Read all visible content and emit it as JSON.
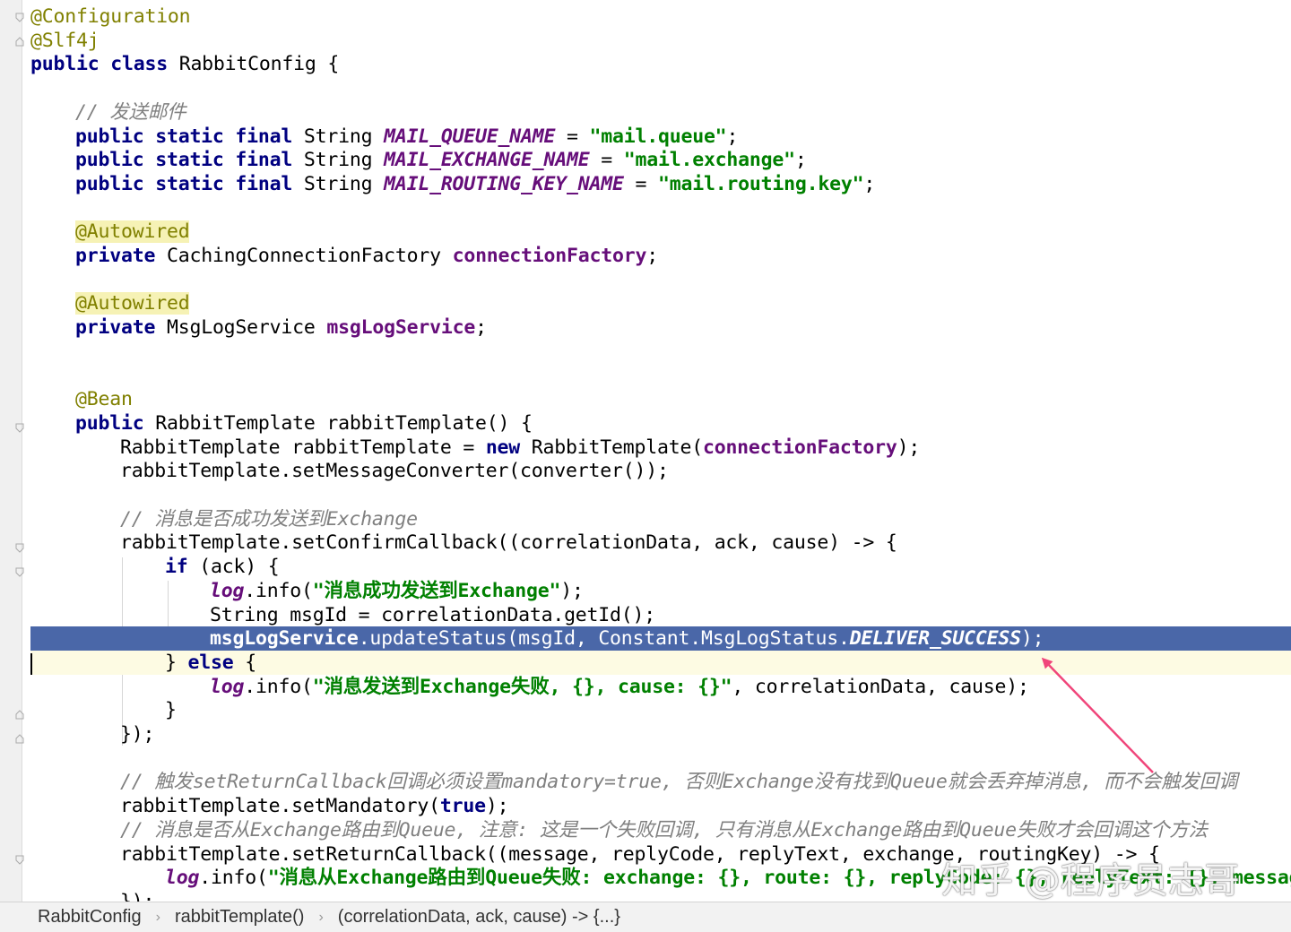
{
  "editor": {
    "lines": [
      {
        "indent": 0,
        "tokens": [
          {
            "text": "@Configuration",
            "c": "ann"
          }
        ]
      },
      {
        "indent": 0,
        "tokens": [
          {
            "text": "@Slf4j",
            "c": "ann"
          }
        ]
      },
      {
        "indent": 0,
        "tokens": [
          {
            "text": "public",
            "c": "kw"
          },
          {
            "text": " "
          },
          {
            "text": "class",
            "c": "kw"
          },
          {
            "text": " RabbitConfig {"
          }
        ]
      },
      {
        "indent": 0,
        "tokens": []
      },
      {
        "indent": 1,
        "tokens": [
          {
            "text": "// 发送邮件",
            "c": "cmt"
          }
        ]
      },
      {
        "indent": 1,
        "tokens": [
          {
            "text": "public static final",
            "c": "kw"
          },
          {
            "text": " String "
          },
          {
            "text": "MAIL_QUEUE_NAME",
            "c": "cst"
          },
          {
            "text": " = "
          },
          {
            "text": "\"mail.queue\"",
            "c": "str"
          },
          {
            "text": ";"
          }
        ]
      },
      {
        "indent": 1,
        "tokens": [
          {
            "text": "public static final",
            "c": "kw"
          },
          {
            "text": " String "
          },
          {
            "text": "MAIL_EXCHANGE_NAME",
            "c": "cst"
          },
          {
            "text": " = "
          },
          {
            "text": "\"mail.exchange\"",
            "c": "str"
          },
          {
            "text": ";"
          }
        ]
      },
      {
        "indent": 1,
        "tokens": [
          {
            "text": "public static final",
            "c": "kw"
          },
          {
            "text": " String "
          },
          {
            "text": "MAIL_ROUTING_KEY_NAME",
            "c": "cst"
          },
          {
            "text": " = "
          },
          {
            "text": "\"mail.routing.key\"",
            "c": "str"
          },
          {
            "text": ";"
          }
        ]
      },
      {
        "indent": 0,
        "tokens": []
      },
      {
        "indent": 1,
        "tokens": [
          {
            "text": "@Autowired",
            "c": "annhl"
          }
        ]
      },
      {
        "indent": 1,
        "tokens": [
          {
            "text": "private",
            "c": "kw"
          },
          {
            "text": " CachingConnectionFactory "
          },
          {
            "text": "connectionFactory",
            "c": "fld"
          },
          {
            "text": ";"
          }
        ]
      },
      {
        "indent": 0,
        "tokens": []
      },
      {
        "indent": 1,
        "tokens": [
          {
            "text": "@Autowired",
            "c": "annhl"
          }
        ]
      },
      {
        "indent": 1,
        "tokens": [
          {
            "text": "private",
            "c": "kw"
          },
          {
            "text": " MsgLogService "
          },
          {
            "text": "msgLogService",
            "c": "fld"
          },
          {
            "text": ";"
          }
        ]
      },
      {
        "indent": 0,
        "tokens": []
      },
      {
        "indent": 0,
        "tokens": []
      },
      {
        "indent": 1,
        "tokens": [
          {
            "text": "@Bean",
            "c": "ann"
          }
        ]
      },
      {
        "indent": 1,
        "tokens": [
          {
            "text": "public",
            "c": "kw"
          },
          {
            "text": " RabbitTemplate rabbitTemplate() {"
          }
        ]
      },
      {
        "indent": 2,
        "tokens": [
          {
            "text": "RabbitTemplate rabbitTemplate = "
          },
          {
            "text": "new",
            "c": "kw"
          },
          {
            "text": " RabbitTemplate("
          },
          {
            "text": "connectionFactory",
            "c": "fld"
          },
          {
            "text": ");"
          }
        ]
      },
      {
        "indent": 2,
        "tokens": [
          {
            "text": "rabbitTemplate.setMessageConverter(converter());"
          }
        ]
      },
      {
        "indent": 0,
        "tokens": []
      },
      {
        "indent": 2,
        "tokens": [
          {
            "text": "// 消息是否成功发送到Exchange",
            "c": "cmt"
          }
        ]
      },
      {
        "indent": 2,
        "tokens": [
          {
            "text": "rabbitTemplate.setConfirmCallback((correlationData, ack, cause) -> {"
          }
        ]
      },
      {
        "indent": 3,
        "tokens": [
          {
            "text": "if",
            "c": "kw"
          },
          {
            "text": " (ack) {"
          }
        ]
      },
      {
        "indent": 4,
        "tokens": [
          {
            "text": "log",
            "c": "cst"
          },
          {
            "text": ".info("
          },
          {
            "text": "\"消息成功发送到Exchange\"",
            "c": "str"
          },
          {
            "text": ");"
          }
        ]
      },
      {
        "indent": 4,
        "tokens": [
          {
            "text": "String msgId = correlationData.getId();"
          }
        ]
      },
      {
        "indent": 4,
        "selected": true,
        "tokens": [
          {
            "text": "msgLogService",
            "c": "fld"
          },
          {
            "text": ".updateStatus(msgId, Constant.MsgLogStatus."
          },
          {
            "text": "DELIVER_SUCCESS",
            "c": "cst"
          },
          {
            "text": ");"
          }
        ]
      },
      {
        "indent": 3,
        "caret": true,
        "tokens": [
          {
            "text": "} "
          },
          {
            "text": "else",
            "c": "kw"
          },
          {
            "text": " {"
          }
        ]
      },
      {
        "indent": 4,
        "tokens": [
          {
            "text": "log",
            "c": "cst"
          },
          {
            "text": ".info("
          },
          {
            "text": "\"消息发送到Exchange失败, {}, cause: {}\"",
            "c": "str"
          },
          {
            "text": ", correlationData, cause);"
          }
        ]
      },
      {
        "indent": 3,
        "tokens": [
          {
            "text": "}"
          }
        ]
      },
      {
        "indent": 2,
        "tokens": [
          {
            "text": "});"
          }
        ]
      },
      {
        "indent": 0,
        "tokens": []
      },
      {
        "indent": 2,
        "tokens": [
          {
            "text": "// 触发setReturnCallback回调必须设置mandatory=true, 否则Exchange没有找到Queue就会丢弃掉消息, 而不会触发回调",
            "c": "cmt"
          }
        ]
      },
      {
        "indent": 2,
        "tokens": [
          {
            "text": "rabbitTemplate.setMandatory("
          },
          {
            "text": "true",
            "c": "kw"
          },
          {
            "text": ");"
          }
        ]
      },
      {
        "indent": 2,
        "tokens": [
          {
            "text": "// 消息是否从Exchange路由到Queue, 注意: 这是一个失败回调, 只有消息从Exchange路由到Queue失败才会回调这个方法",
            "c": "cmt"
          }
        ]
      },
      {
        "indent": 2,
        "tokens": [
          {
            "text": "rabbitTemplate.setReturnCallback((message, replyCode, replyText, exchange, routingKey) -> {"
          }
        ]
      },
      {
        "indent": 3,
        "tokens": [
          {
            "text": "log",
            "c": "cst"
          },
          {
            "text": ".info("
          },
          {
            "text": "\"消息从Exchange路由到Queue失败: exchange: {}, route: {}, replyCode: {}, replyText: {}, message",
            "c": "str"
          }
        ]
      },
      {
        "indent": 2,
        "tokens": [
          {
            "text": "});"
          }
        ]
      }
    ]
  },
  "watermark": "知乎 @程序员志哥",
  "breadcrumb": {
    "items": [
      "RabbitConfig",
      "rabbitTemplate()",
      "(correlationData, ack, cause) -> {...}"
    ],
    "separator": "›"
  },
  "colors": {
    "keyword": "#000080",
    "annotation": "#808000",
    "string": "#008000",
    "field": "#660e7a",
    "comment": "#808080",
    "selection": "#4a67a8",
    "arrow": "#f0457a"
  }
}
